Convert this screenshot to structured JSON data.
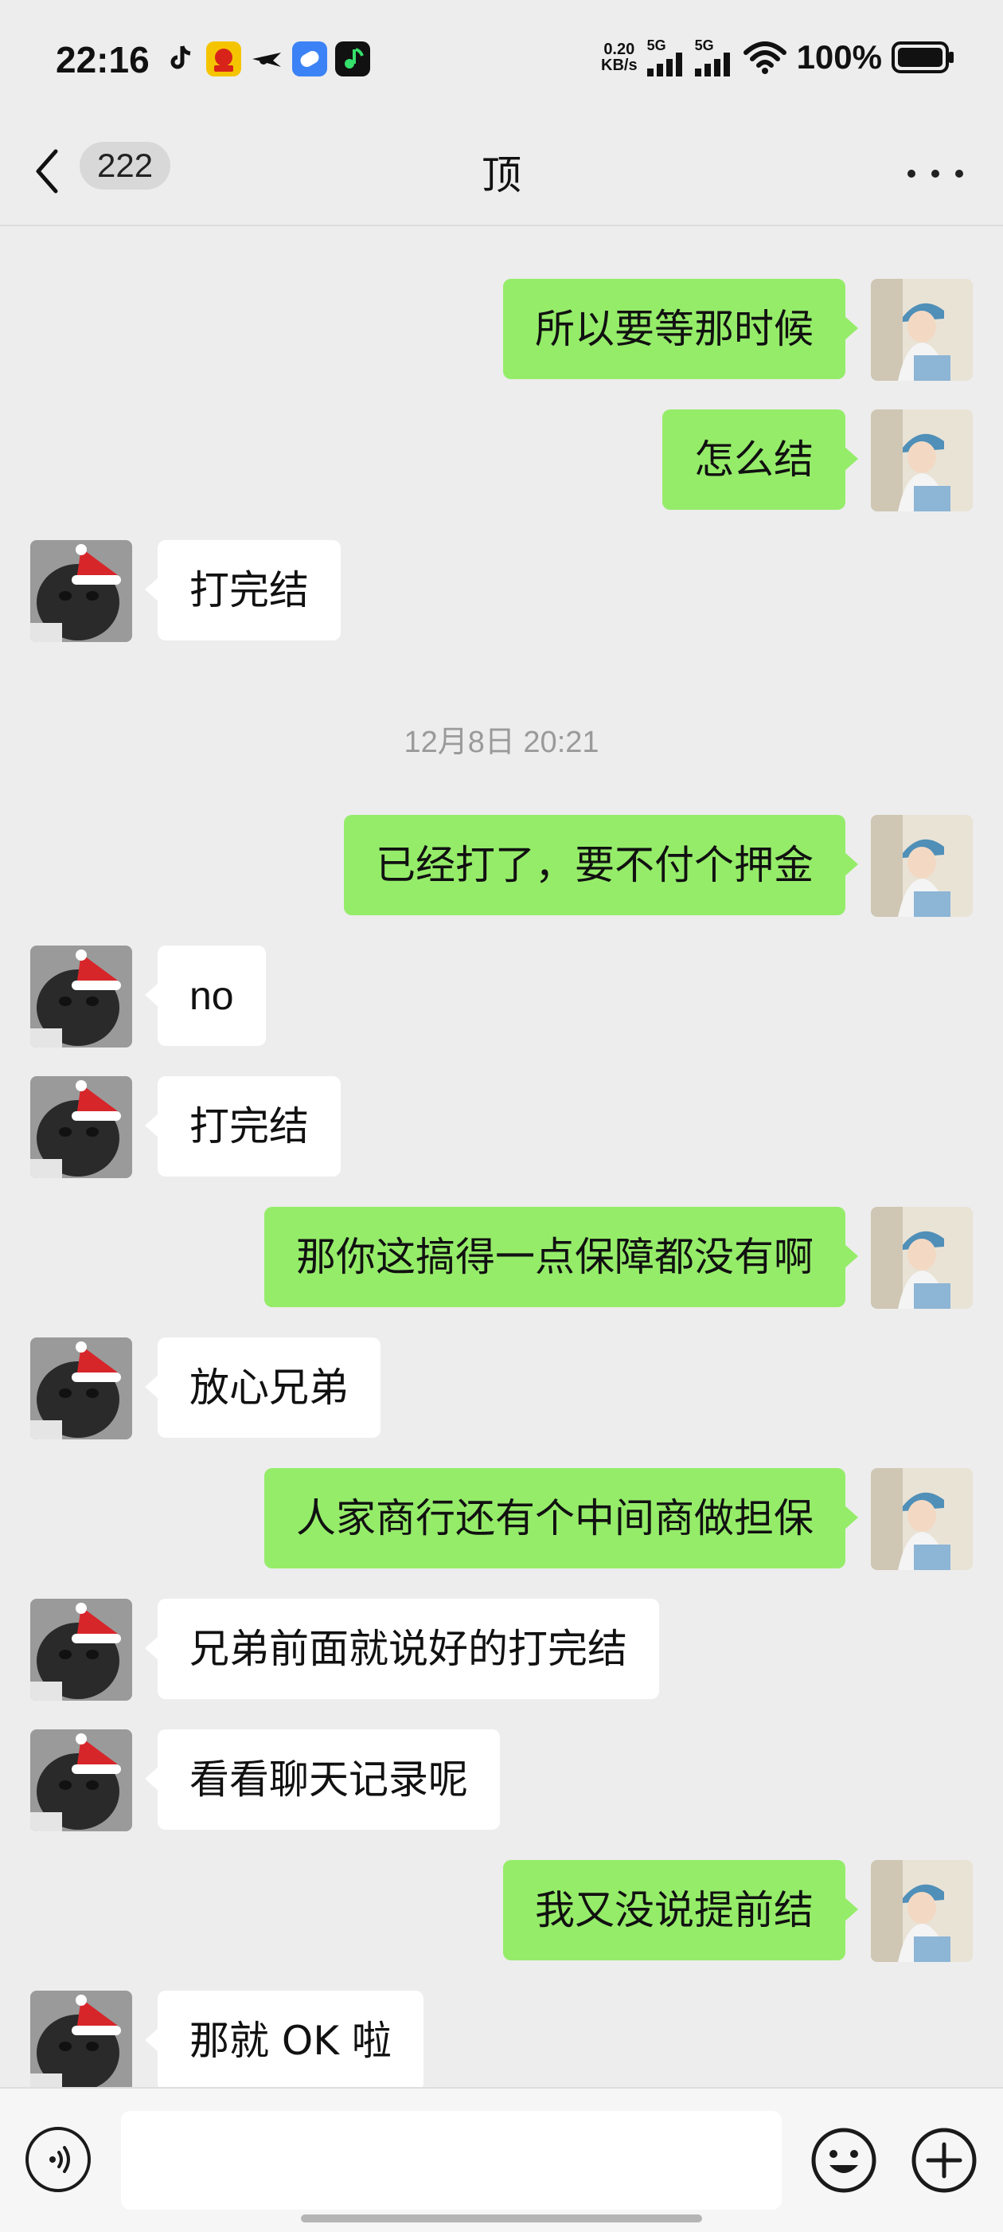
{
  "status_bar": {
    "time": "22:16",
    "net_speed_value": "0.20",
    "net_speed_unit": "KB/s",
    "sim1": "5G",
    "sim2": "5G",
    "battery": "100%"
  },
  "header": {
    "unread_count": "222",
    "title": "顶"
  },
  "messages": [
    {
      "side": "me",
      "text": "所以要等那时候"
    },
    {
      "side": "me",
      "text": "怎么结"
    },
    {
      "side": "other",
      "text": "打完结"
    },
    {
      "type": "timestamp",
      "text": "12月8日 20:21"
    },
    {
      "side": "me",
      "text": "已经打了，要不付个押金"
    },
    {
      "side": "other",
      "text": "no"
    },
    {
      "side": "other",
      "text": "打完结"
    },
    {
      "side": "me",
      "text": "那你这搞得一点保障都没有啊"
    },
    {
      "side": "other",
      "text": "放心兄弟"
    },
    {
      "side": "me",
      "text": "人家商行还有个中间商做担保"
    },
    {
      "side": "other",
      "text": "兄弟前面就说好的打完结"
    },
    {
      "side": "other",
      "text": "看看聊天记录呢"
    },
    {
      "side": "me",
      "text": "我又没说提前结"
    },
    {
      "side": "other",
      "text": "那就 OK 啦"
    }
  ],
  "input_bar": {
    "voice_icon": "voice-icon",
    "emoji_icon": "emoji-icon",
    "plus_icon": "plus-icon"
  },
  "colors": {
    "background": "#ededed",
    "my_bubble": "#95ec69",
    "other_bubble": "#ffffff"
  }
}
